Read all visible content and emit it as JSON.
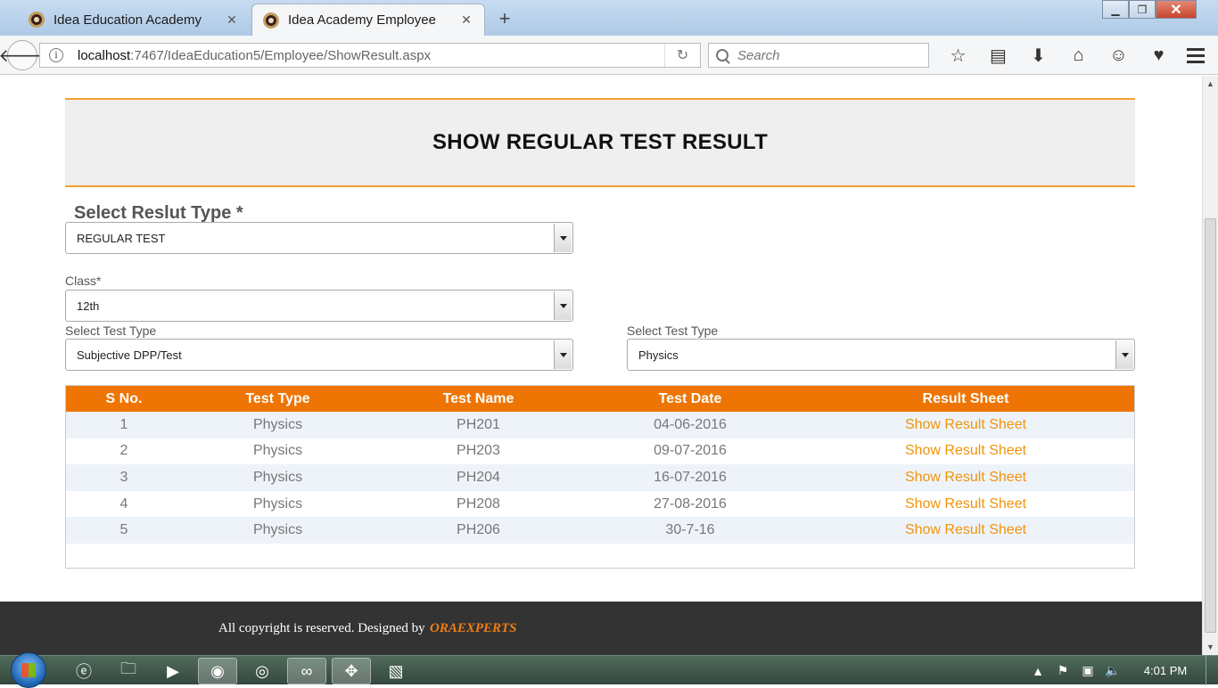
{
  "browser": {
    "tabs": [
      {
        "title": "Idea Education Academy",
        "close": "✕"
      },
      {
        "title": "Idea Academy Employee",
        "close": "✕"
      }
    ],
    "new_tab": "+",
    "url_host": "localhost",
    "url_rest": ":7467/IdeaEducation5/Employee/ShowResult.aspx",
    "search_placeholder": "Search"
  },
  "page": {
    "header_title": "SHOW REGULAR TEST RESULT",
    "result_type_label": "Select Reslut Type *",
    "result_type_value": "REGULAR TEST",
    "class_label": "Class*",
    "class_value": "12th",
    "test_type_label_left": "Select Test Type",
    "test_type_value_left": "Subjective DPP/Test",
    "test_type_label_right": "Select Test Type",
    "test_type_value_right": "Physics",
    "table": {
      "headers": [
        "S No.",
        "Test Type",
        "Test Name",
        "Test Date",
        "Result Sheet"
      ],
      "rows": [
        {
          "sno": "1",
          "type": "Physics",
          "name": "PH201",
          "date": "04-06-2016",
          "link": "Show Result Sheet"
        },
        {
          "sno": "2",
          "type": "Physics",
          "name": "PH203",
          "date": "09-07-2016",
          "link": "Show Result Sheet"
        },
        {
          "sno": "3",
          "type": "Physics",
          "name": "PH204",
          "date": "16-07-2016",
          "link": "Show Result Sheet"
        },
        {
          "sno": "4",
          "type": "Physics",
          "name": "PH208",
          "date": "27-08-2016",
          "link": "Show Result Sheet"
        },
        {
          "sno": "5",
          "type": "Physics",
          "name": "PH206",
          "date": "30-7-16",
          "link": "Show Result Sheet"
        }
      ]
    },
    "footer_text": "All copyright is reserved. Designed by",
    "footer_brand": "ORAEXPERTS"
  },
  "taskbar": {
    "clock": "4:01 PM"
  },
  "colors": {
    "accent_orange": "#ee7503",
    "link_orange": "#f0940a",
    "footer_bg": "#333333"
  }
}
